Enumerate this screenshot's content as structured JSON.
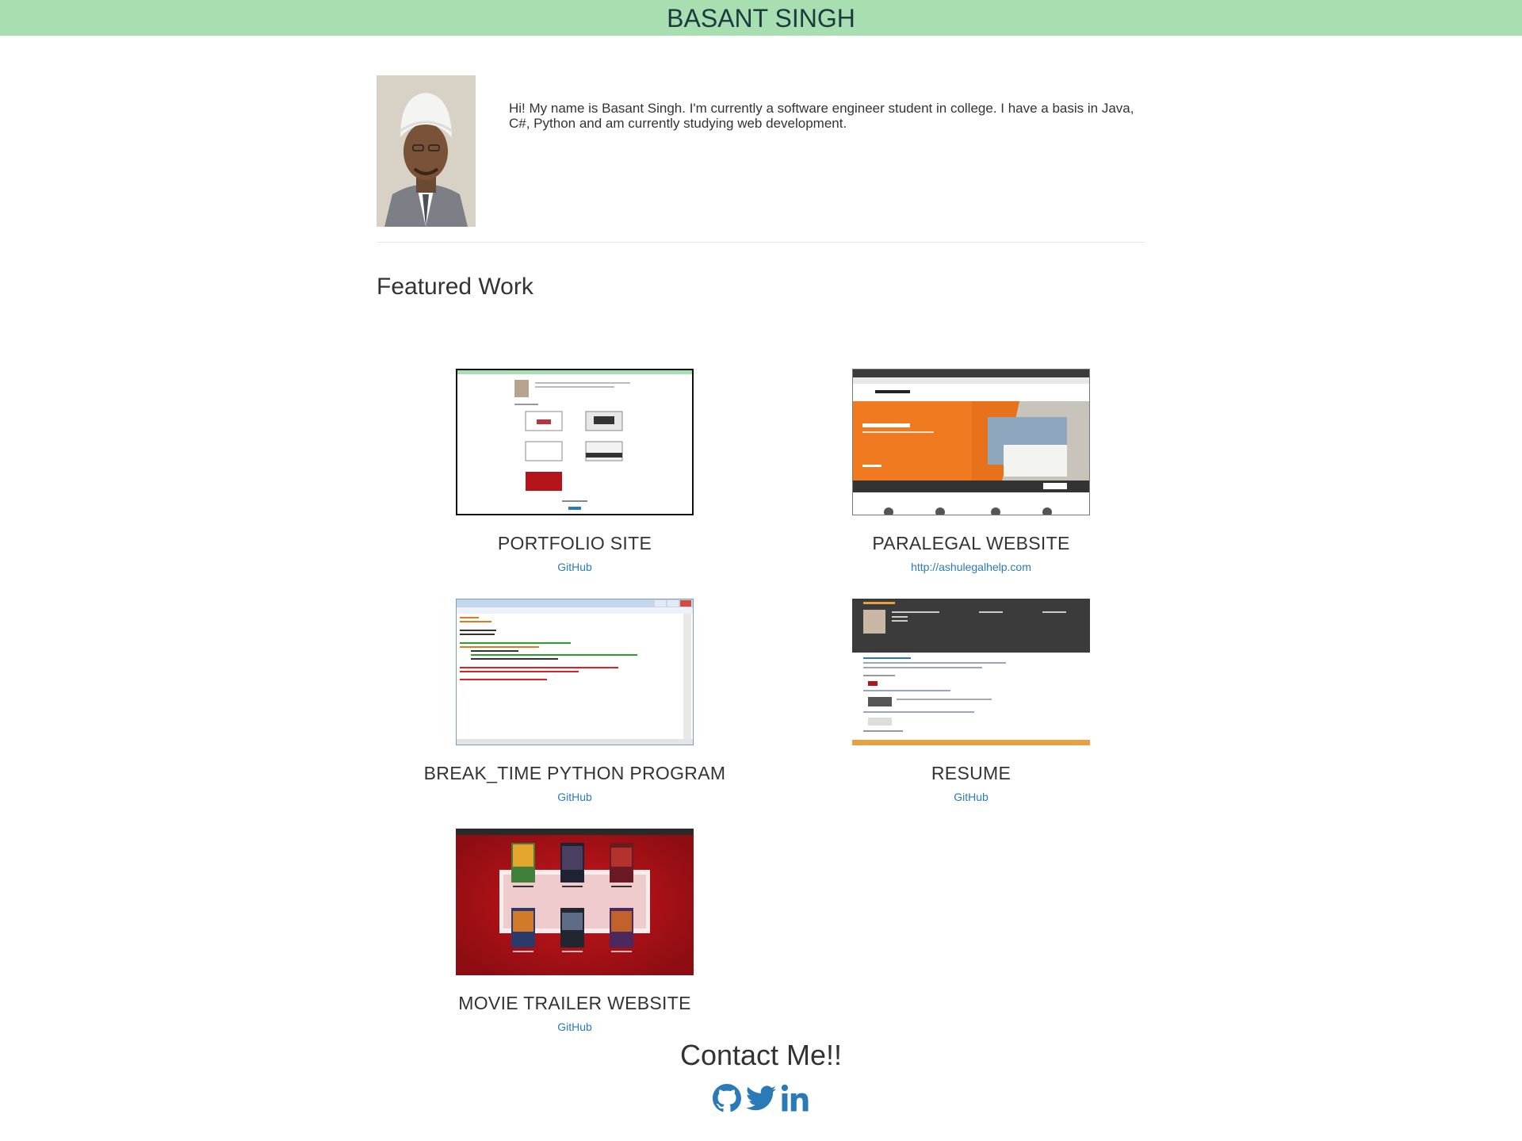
{
  "header": {
    "title": "BASANT SINGH"
  },
  "intro": {
    "bio": "Hi! My name is Basant Singh. I'm currently a software engineer student in college. I have a basis in Java, C#, Python and am currently studying web development."
  },
  "featured": {
    "heading": "Featured Work",
    "projects": [
      {
        "title": "PORTFOLIO SITE",
        "link": "GitHub"
      },
      {
        "title": "PARALEGAL WEBSITE",
        "link": "http://ashulegalhelp.com"
      },
      {
        "title": "BREAK_TIME PYTHON PROGRAM",
        "link": "GitHub"
      },
      {
        "title": "RESUME",
        "link": "GitHub"
      },
      {
        "title": "MOVIE TRAILER WEBSITE",
        "link": "GitHub"
      }
    ]
  },
  "contact": {
    "heading": "Contact Me!!",
    "icons": [
      "github-icon",
      "twitter-icon",
      "linkedin-icon"
    ]
  },
  "colors": {
    "header_bg": "#a8dfb0",
    "link": "#2a7ab8",
    "marvel_red": "#b4141a"
  }
}
